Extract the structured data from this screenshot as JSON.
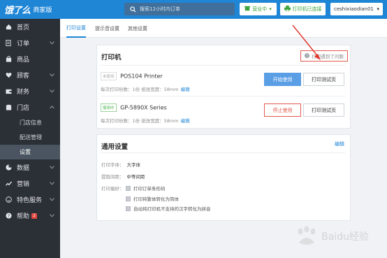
{
  "topbar": {
    "logo": "饿了么",
    "logo_sub": "商家版",
    "search_placeholder": "搜索12小时内订单",
    "status_label": "营业中",
    "printer_status": "打印机已连接",
    "username": "ceshixiaodian01"
  },
  "sidebar": {
    "items": [
      {
        "label": "首页",
        "icon": "home-icon"
      },
      {
        "label": "订单",
        "icon": "document-icon"
      },
      {
        "label": "商品",
        "icon": "bag-icon"
      },
      {
        "label": "顾客",
        "icon": "heart-icon"
      },
      {
        "label": "财务",
        "icon": "wallet-icon"
      },
      {
        "label": "门店",
        "icon": "store-icon"
      },
      {
        "label": "数据",
        "icon": "pie-icon"
      },
      {
        "label": "营销",
        "icon": "trend-icon"
      },
      {
        "label": "特色服务",
        "icon": "smile-icon"
      },
      {
        "label": "帮助",
        "icon": "help-icon",
        "badge": "2"
      }
    ],
    "store_sub": [
      "门店信息",
      "配送管理",
      "设置"
    ]
  },
  "tabs": [
    "打印设置",
    "提示音设置",
    "其他设置"
  ],
  "printer_card": {
    "title": "打印机",
    "help": "打印遇到了问题",
    "printers": [
      {
        "tag": "未使用",
        "name": "POS104 Printer",
        "meta": "每次打印份数：1份  纸张宽度：58mm",
        "edit": "编辑",
        "primary": "开始使用",
        "test": "打印测试页"
      },
      {
        "tag": "使用中",
        "name": "GP-5890X Series",
        "meta": "每次打印份数：1份  纸张宽度：58mm",
        "edit": "编辑",
        "primary": "停止使用",
        "test": "打印测试页"
      }
    ]
  },
  "general_card": {
    "title": "通用设置",
    "edit": "编辑",
    "font_label": "打印字体：",
    "font_value": "大字体",
    "spacing_label": "提取间距：",
    "spacing_value": "中等间距",
    "pref_label": "打印偏好：",
    "prefs": [
      "打印订单条形码",
      "打印将繁体转化为简体",
      "自动将打印机不支持的汉字转化为拼音"
    ]
  },
  "watermark": "Baidu经验",
  "colors": {
    "brand": "#1f86d6",
    "sidebar": "#2b2f36",
    "danger": "#e05a4f",
    "success": "#3aa13a"
  }
}
